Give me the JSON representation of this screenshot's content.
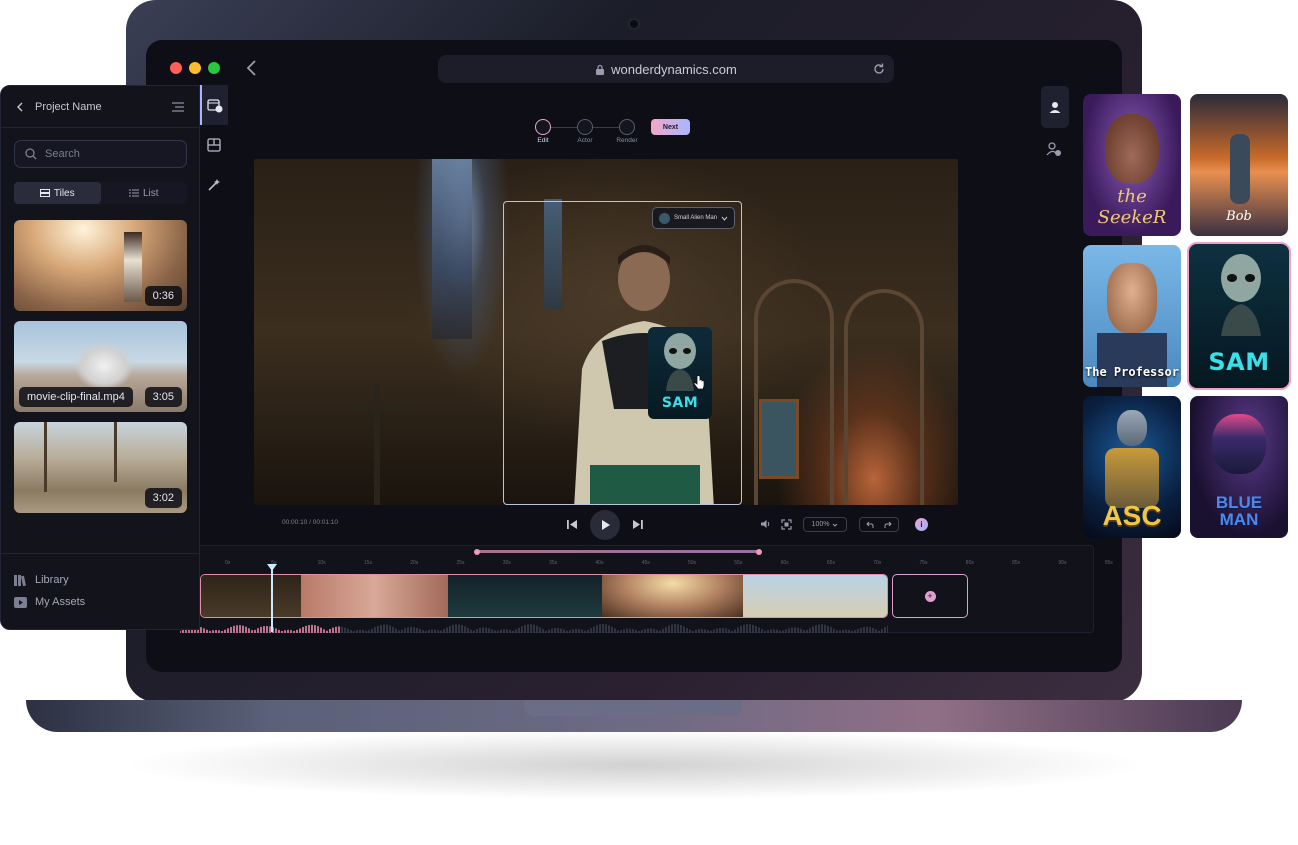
{
  "browser": {
    "url": "wonderdynamics.com"
  },
  "steps": [
    {
      "label": "Edit"
    },
    {
      "label": "Actor"
    },
    {
      "label": "Render"
    }
  ],
  "next_button": "Next",
  "actor_chip": {
    "label": "Small Alien Man"
  },
  "player": {
    "time": "00:00:10 / 00:01:10",
    "zoom": "100%"
  },
  "timeline": {
    "ticks": [
      "0s",
      "5s",
      "10s",
      "15s",
      "20s",
      "25s",
      "30s",
      "35s",
      "40s",
      "45s",
      "50s",
      "55s",
      "60s",
      "65s",
      "70s",
      "75s",
      "80s",
      "85s",
      "90s",
      "95s"
    ]
  },
  "sidebar": {
    "project_name": "Project Name",
    "search_placeholder": "Search",
    "tabs": {
      "tiles": "Tiles",
      "list": "List"
    },
    "clips": [
      {
        "duration": "0:36"
      },
      {
        "duration": "3:05",
        "filename": "movie-clip-final.mp4"
      },
      {
        "duration": "3:02"
      }
    ],
    "nav": {
      "library": "Library",
      "my_assets": "My Assets"
    }
  },
  "overlay_card": {
    "name": "SAM"
  },
  "actor_cards": [
    {
      "name": "the SeekeR"
    },
    {
      "name": "Bob"
    },
    {
      "name": "The Professor"
    },
    {
      "name": "SAM"
    },
    {
      "name": "ASC"
    },
    {
      "name": "BLUE MAN"
    }
  ]
}
